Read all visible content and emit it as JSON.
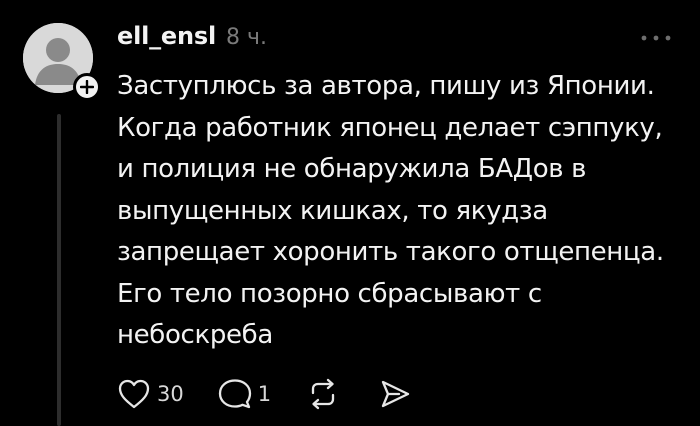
{
  "post": {
    "username": "ell_ensl",
    "time": "8 ч.",
    "text": "Заступлюсь за автора, пишу из Японии.\nКогда  работник японец делает сэппуку,\nи полиция не обнаружила БАДов  в\nвыпущенных кишках, то якудза\nзапрещает хоронить такого отщепенца.\nЕго тело позорно сбрасывают  с\nнебоскреба",
    "like_count": "30",
    "comment_count": "1"
  },
  "icons": {
    "avatar": "default-avatar-icon",
    "follow": "plus-icon",
    "more": "more-dots-icon",
    "like": "heart-icon",
    "comment": "comment-bubble-icon",
    "repost": "repost-icon",
    "share": "send-icon"
  },
  "colors": {
    "background": "#000000",
    "text": "#f3f3f3",
    "muted": "#7a7a7a",
    "avatar": "#d9d9d9",
    "thread_line": "#2d2d2d"
  }
}
